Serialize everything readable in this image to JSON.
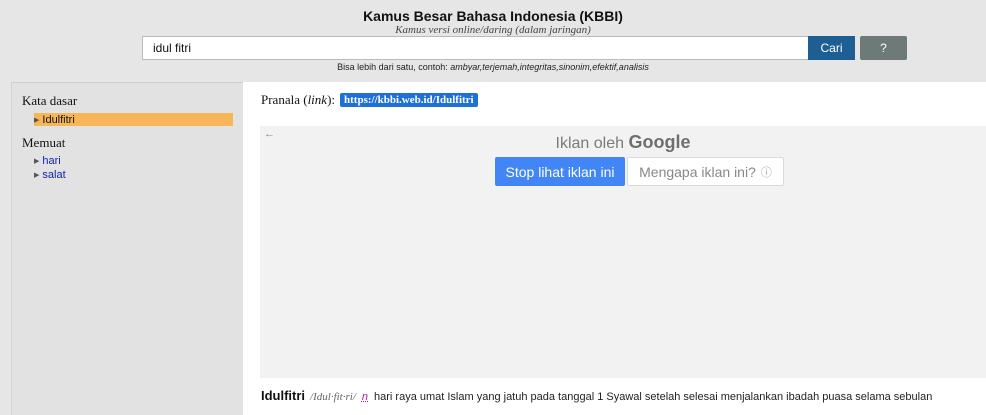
{
  "header": {
    "title": "Kamus Besar Bahasa Indonesia (KBBI)",
    "subtitle": "Kamus versi online/daring (dalam jaringan)"
  },
  "search": {
    "value": "idul fitri",
    "button_label": "Cari",
    "help_label": "?",
    "hint_prefix": "Bisa lebih dari satu, contoh: ",
    "hint_examples": "ambyar,terjemah,integritas,sinonim,efektif,analisis"
  },
  "sidebar": {
    "kata_dasar_heading": "Kata dasar",
    "kata_dasar_items": [
      {
        "label": "Idulfitri",
        "active": true
      }
    ],
    "memuat_heading": "Memuat",
    "memuat_items": [
      {
        "label": "hari"
      },
      {
        "label": "salat"
      }
    ]
  },
  "main": {
    "pranala_prefix": "Pranala (",
    "pranala_link_word": "link",
    "pranala_suffix": "):",
    "pranala_url": "https://kbbi.web.id/Idulfitri"
  },
  "ad": {
    "back_icon": "back-arrow-icon",
    "label_prefix": "Iklan oleh ",
    "label_brand": "Google",
    "stop_button": "Stop lihat iklan ini",
    "why_button": "Mengapa iklan ini?",
    "info_icon": "info-icon"
  },
  "entry": {
    "term": "Idulfitri",
    "syllables": "/Idul·fit·ri/",
    "word_class": "n",
    "definition": "hari raya umat Islam yang jatuh pada tanggal 1 Syawal setelah selesai menjalankan ibadah puasa selama sebulan"
  },
  "colors": {
    "page_bg": "#e6e6e6",
    "cari_button": "#1d5f93",
    "help_button": "#6e7a78",
    "active_item": "#f7b758",
    "link_badge": "#1e6fd6",
    "ad_stop_button": "#4285f4",
    "word_class": "#a321a3"
  }
}
